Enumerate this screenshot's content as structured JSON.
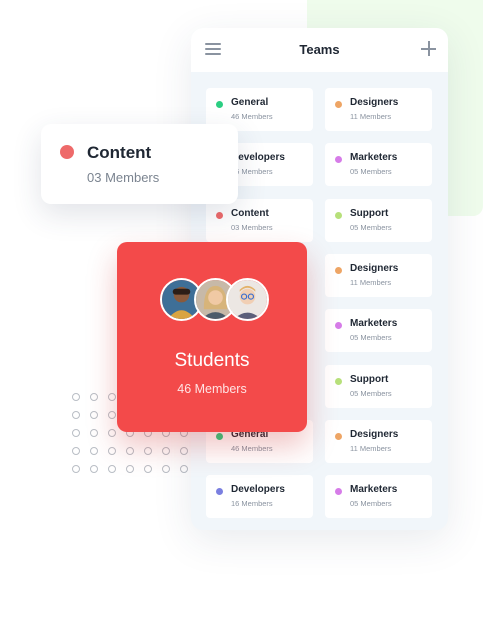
{
  "panel": {
    "title": "Teams",
    "menu_icon": "hamburger-icon",
    "add_icon": "plus-icon"
  },
  "teams": [
    {
      "name": "General",
      "members": "46 Members",
      "color": "#2bce82"
    },
    {
      "name": "Designers",
      "members": "11 Members",
      "color": "#eea565"
    },
    {
      "name": "Developers",
      "members": "16 Members",
      "color": "#7a7fe0"
    },
    {
      "name": "Marketers",
      "members": "05 Members",
      "color": "#d67ce8"
    },
    {
      "name": "Content",
      "members": "03 Members",
      "color": "#ee6a6a"
    },
    {
      "name": "Support",
      "members": "05 Members",
      "color": "#b7e07a"
    },
    {
      "name": "Designers",
      "members": "11 Members",
      "color": "#eea565"
    },
    {
      "name": "Marketers",
      "members": "05 Members",
      "color": "#d67ce8"
    },
    {
      "name": "Support",
      "members": "05 Members",
      "color": "#b7e07a"
    },
    {
      "name": "General",
      "members": "46 Members",
      "color": "#2bce82"
    },
    {
      "name": "Designers",
      "members": "11 Members",
      "color": "#eea565"
    },
    {
      "name": "Developers",
      "members": "16 Members",
      "color": "#7a7fe0"
    },
    {
      "name": "Marketers",
      "members": "05 Members",
      "color": "#d67ce8"
    }
  ],
  "featured_content": {
    "name": "Content",
    "members": "03 Members",
    "color": "#ee6a6a"
  },
  "featured_students": {
    "name": "Students",
    "members": "46 Members",
    "color": "#f34a4a"
  },
  "colors": {
    "panel_bg": "#f1f6fa",
    "accent_green_bg": "#effcec"
  }
}
